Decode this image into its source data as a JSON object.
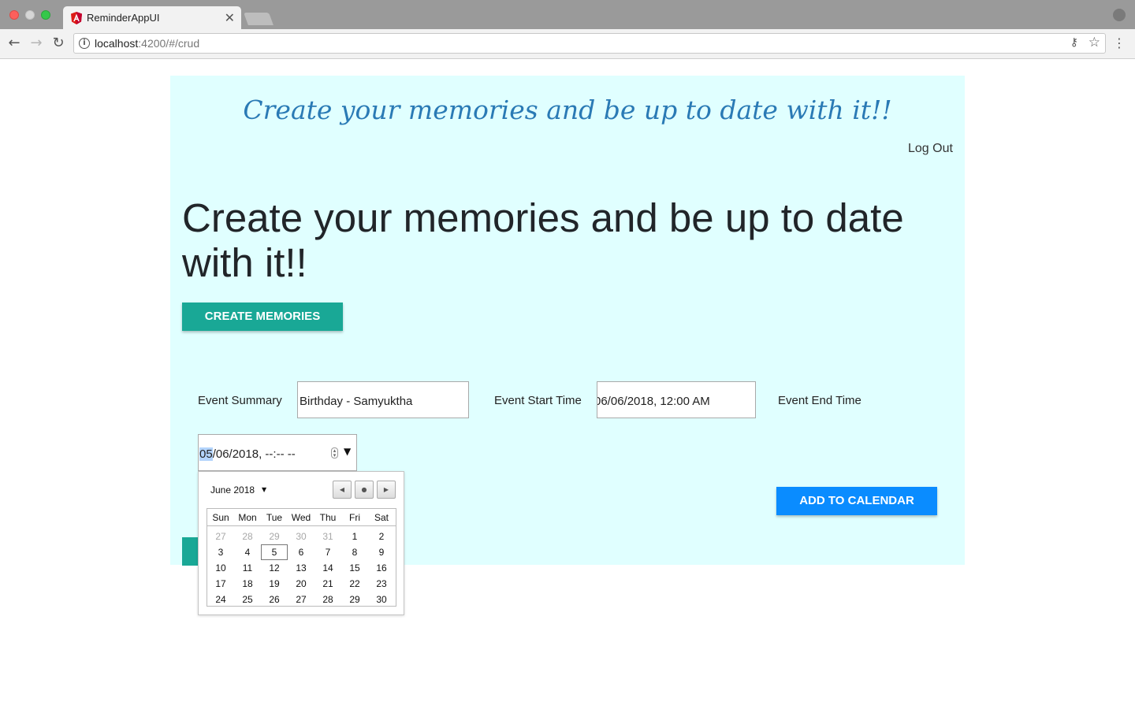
{
  "browser": {
    "tab_title": "ReminderAppUI",
    "tab_close": "✕",
    "url_host": "localhost",
    "url_path": ":4200/#/crud"
  },
  "page": {
    "tagline": "Create your memories and be up to date with it!!",
    "logout": "Log Out",
    "hero": "Create your memories and be up to date with it!!",
    "create_button": "CREATE MEMORIES",
    "add_button": "ADD TO CALENDAR"
  },
  "form": {
    "summary_label": "Event Summary",
    "summary_value": "Birthday - Samyuktha",
    "start_label": "Event Start Time",
    "start_value": "06/06/2018, 12:00 AM",
    "end_label": "Event End Time",
    "end_value_month": "05",
    "end_value_rest": "/06/2018, --:-- --"
  },
  "calendar": {
    "month_label": "June 2018",
    "weekdays": [
      "Sun",
      "Mon",
      "Tue",
      "Wed",
      "Thu",
      "Fri",
      "Sat"
    ],
    "weeks": [
      [
        "27",
        "28",
        "29",
        "30",
        "31",
        "1",
        "2"
      ],
      [
        "3",
        "4",
        "5",
        "6",
        "7",
        "8",
        "9"
      ],
      [
        "10",
        "11",
        "12",
        "13",
        "14",
        "15",
        "16"
      ],
      [
        "17",
        "18",
        "19",
        "20",
        "21",
        "22",
        "23"
      ],
      [
        "24",
        "25",
        "26",
        "27",
        "28",
        "29",
        "30"
      ]
    ],
    "other_month_days": [
      "27",
      "28",
      "29",
      "30",
      "31"
    ],
    "today": "5"
  },
  "icons": {
    "back": "back-arrow-icon",
    "forward": "forward-arrow-icon",
    "reload": "reload-icon",
    "info": "info-icon",
    "key": "key-icon",
    "star": "star-icon",
    "menu": "menu-icon",
    "favicon": "angular-icon",
    "profile": "profile-icon"
  },
  "colors": {
    "panel_bg": "#e0ffff",
    "tagline": "#2a7ab5",
    "create_button": "#19a896",
    "add_button": "#0a8cff",
    "selection": "#b3d4fc"
  }
}
